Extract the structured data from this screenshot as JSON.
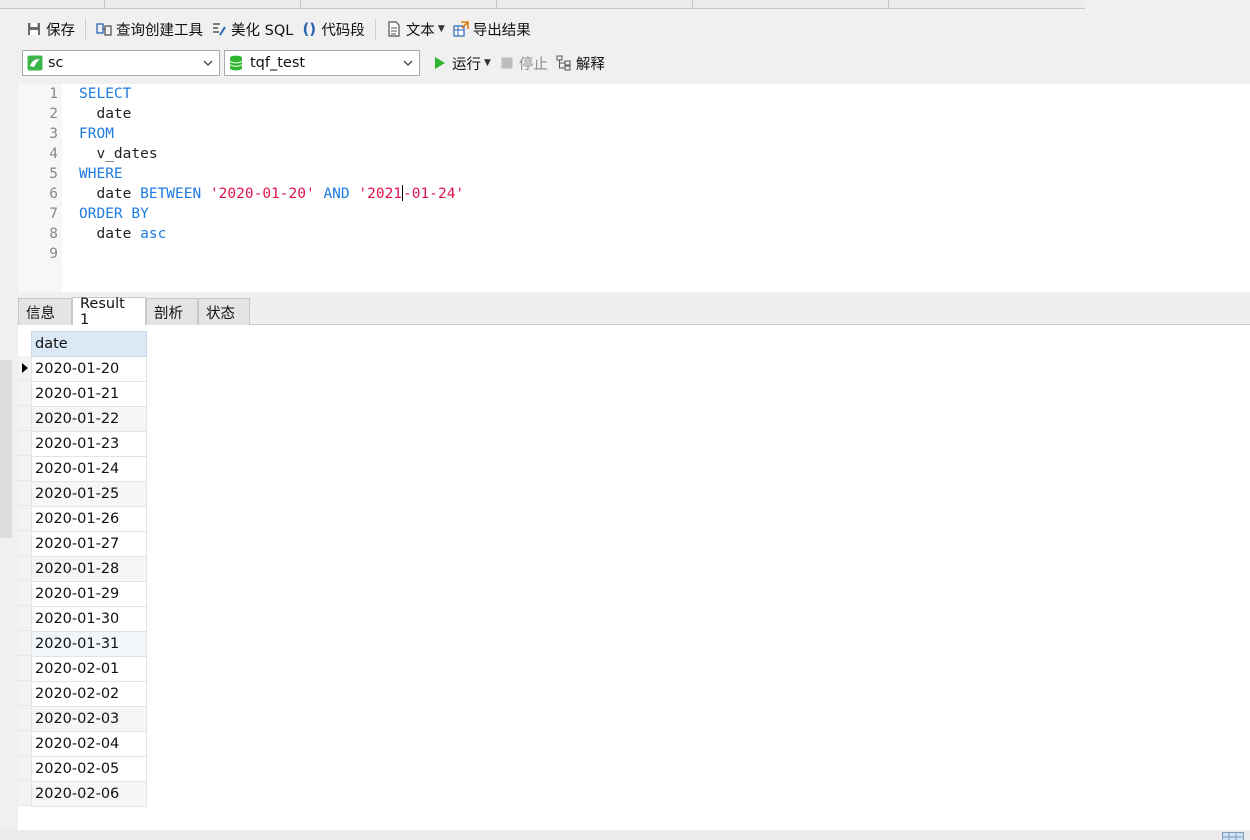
{
  "toolbar": {
    "save": "保存",
    "query_builder": "查询创建工具",
    "beautify": "美化 SQL",
    "snippet": "代码段",
    "text": "文本",
    "export": "导出结果"
  },
  "connection": {
    "connection_value": "sc",
    "database_value": "tqf_test",
    "run": "运行",
    "stop": "停止",
    "explain": "解释"
  },
  "editor": {
    "line_numbers": [
      "1",
      "2",
      "3",
      "4",
      "5",
      "6",
      "7",
      "8",
      "9"
    ],
    "l1_kw": "SELECT",
    "l2_text": "  date",
    "l3_kw": "FROM",
    "l4_text": "  v_dates",
    "l5_kw": "WHERE",
    "l6_a": "  date ",
    "l6_kw1": "BETWEEN",
    "l6_str1": "'2020-01-20'",
    "l6_kw2": "AND",
    "l6_str2a": "'2021",
    "l6_str2b": "-01-24'",
    "l7_kw": "ORDER BY",
    "l8_a": "  date ",
    "l8_kw": "asc"
  },
  "result_tabs": [
    "信息",
    "Result 1",
    "剖析",
    "状态"
  ],
  "grid": {
    "column": "date",
    "rows": [
      "2020-01-20",
      "2020-01-21",
      "2020-01-22",
      "2020-01-23",
      "2020-01-24",
      "2020-01-25",
      "2020-01-26",
      "2020-01-27",
      "2020-01-28",
      "2020-01-29",
      "2020-01-30",
      "2020-01-31",
      "2020-02-01",
      "2020-02-02",
      "2020-02-03",
      "2020-02-04",
      "2020-02-05",
      "2020-02-06"
    ]
  },
  "colors": {
    "keyword": "#1e7be0",
    "string": "#e0144c",
    "header_bg": "#dbe9f7",
    "run_green": "#2db52d"
  }
}
